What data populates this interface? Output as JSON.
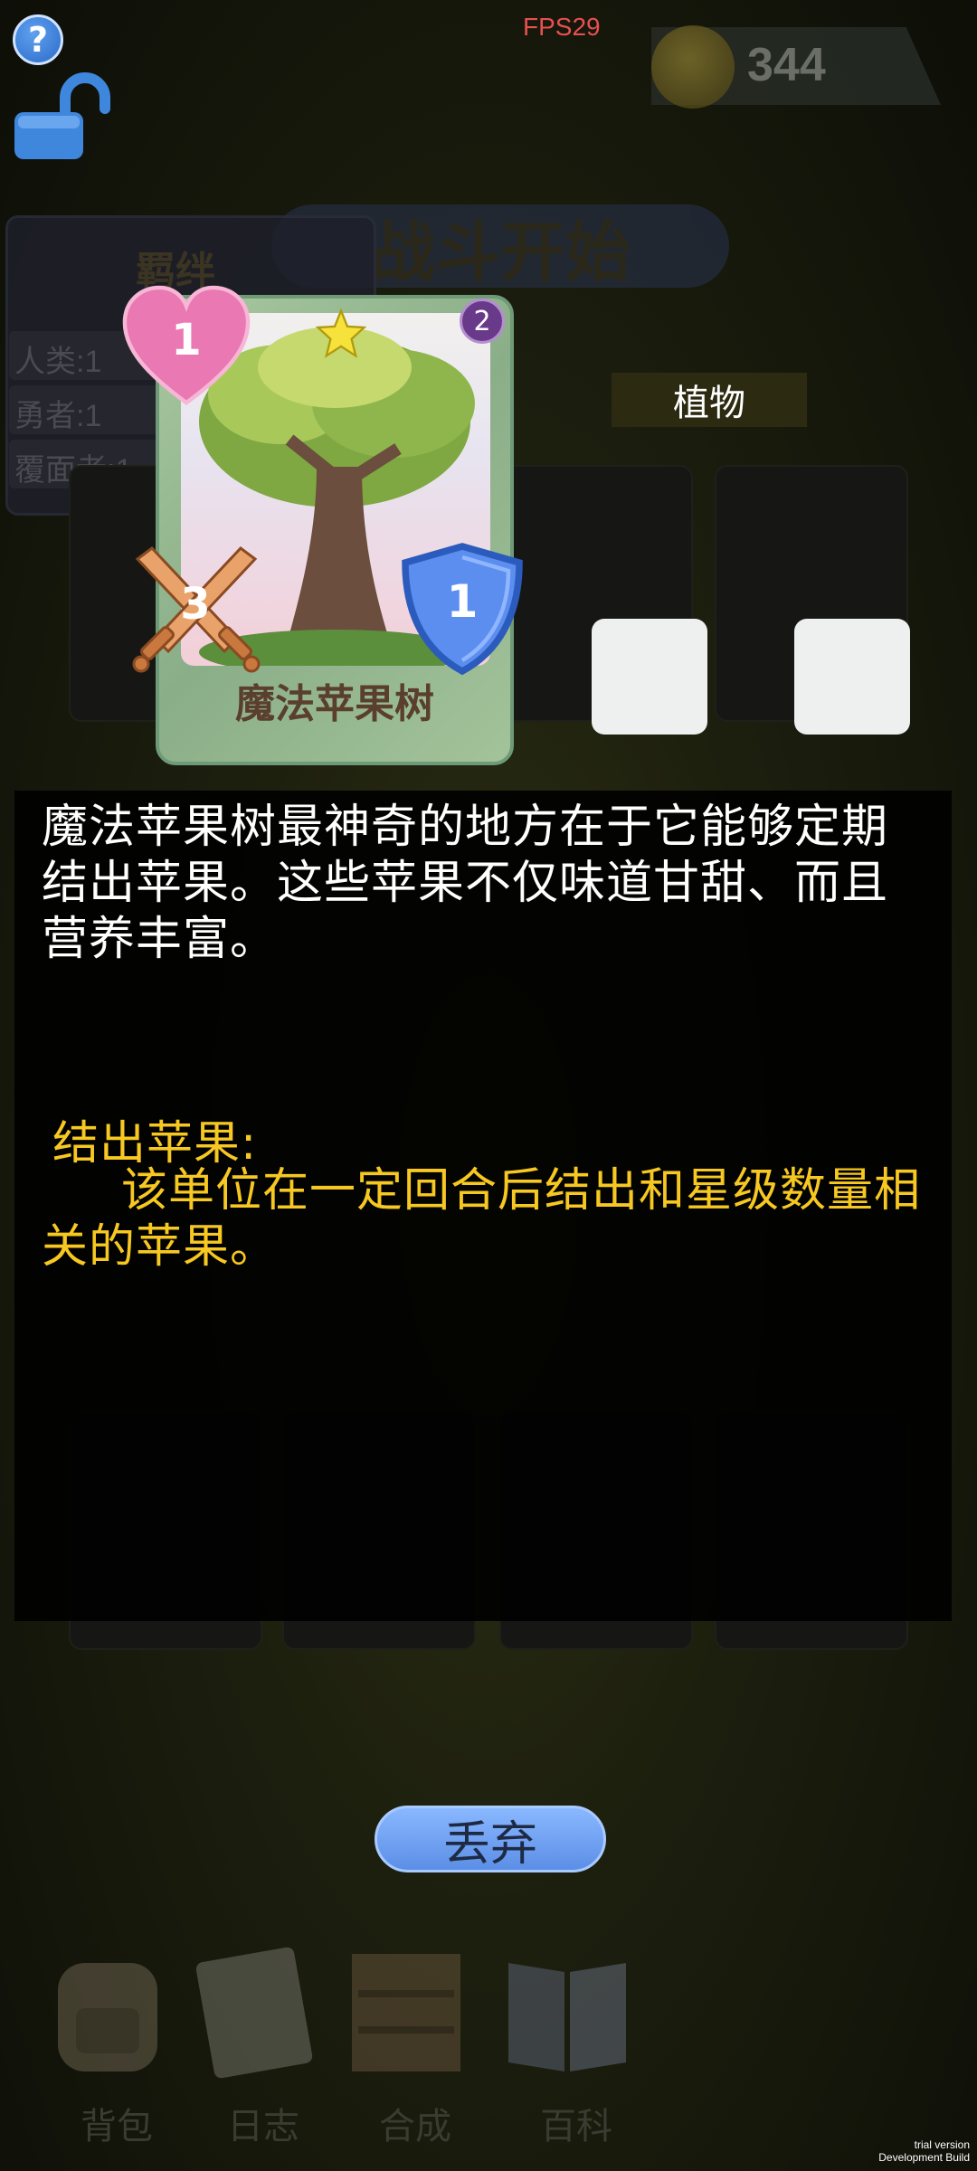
{
  "top_bar": {
    "help_label": "?",
    "fps_text": "FPS29",
    "coins": "344"
  },
  "background": {
    "battle_banner": "战斗开始",
    "bonds_title": "羁绊",
    "bond_rows": [
      "人类:1",
      "勇者:1",
      "覆面者:1"
    ],
    "category_tag": "植物"
  },
  "card": {
    "name": "魔法苹果树",
    "health": "1",
    "attack": "3",
    "defense": "1",
    "level": "2",
    "stars": 1
  },
  "description": {
    "text": "魔法苹果树最神奇的地方在于它能够定期结出苹果。这些苹果不仅味道甘甜、而且营养丰富。",
    "skill_title": "结出苹果:",
    "skill_text": "该单位在一定回合后结出和星级数量相关的苹果。"
  },
  "discard_button": "丢弃",
  "nav": [
    {
      "label": "背包",
      "icon": "backpack-icon"
    },
    {
      "label": "日志",
      "icon": "journal-icon"
    },
    {
      "label": "合成",
      "icon": "crafting-shelf-icon"
    },
    {
      "label": "百科",
      "icon": "encyclopedia-book-icon"
    }
  ],
  "build_info": [
    "trial version",
    "Development Build"
  ]
}
